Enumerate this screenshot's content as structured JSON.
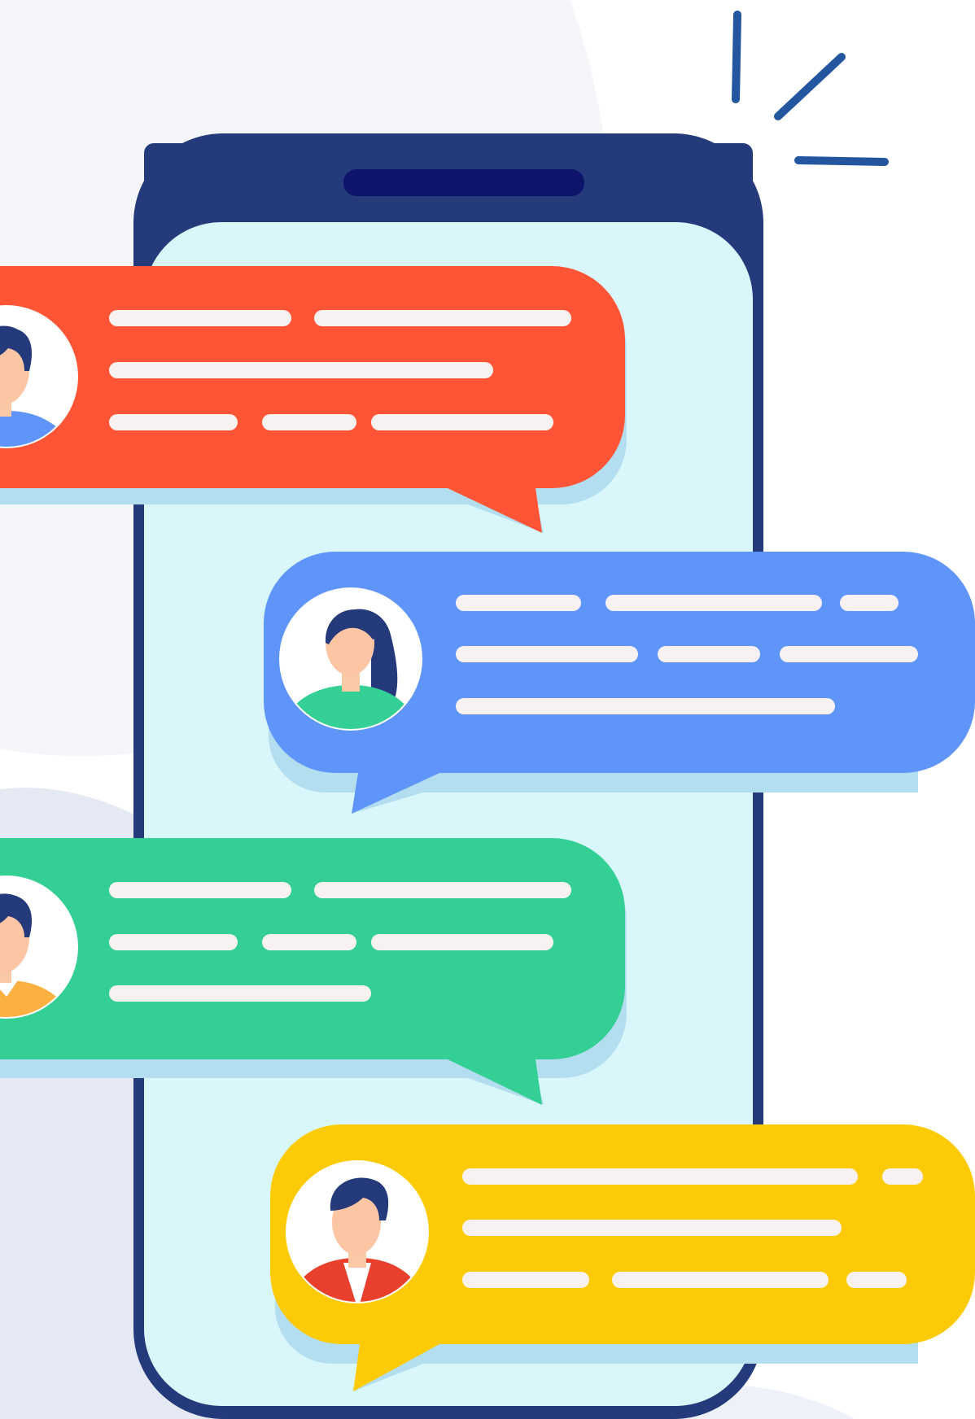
{
  "illustration": {
    "subject": "chat-app-conversation",
    "colors": {
      "background_blob": "#f3f5fa",
      "phone_frame": "#243a7a",
      "phone_screen": "#d9f7fb",
      "phone_notch": "#0d146a",
      "bubble_shadow": "#b2deef",
      "text_line": "#f8f1f1",
      "sparkle": "#2456a0",
      "bubble_red": "#ff5435",
      "bubble_blue": "#5f95f9",
      "bubble_green": "#34cf94",
      "bubble_yellow": "#fccb05"
    },
    "bubbles": [
      {
        "id": "red",
        "color": "#ff5435",
        "avatar": "man-blue-shirt-avatar",
        "text_line_rows": 3
      },
      {
        "id": "blue",
        "color": "#5f95f9",
        "avatar": "woman-green-shirt-avatar",
        "text_line_rows": 3
      },
      {
        "id": "green",
        "color": "#34cf94",
        "avatar": "man-orange-shirt-avatar",
        "text_line_rows": 3
      },
      {
        "id": "yellow",
        "color": "#fccb05",
        "avatar": "man-red-jacket-avatar",
        "text_line_rows": 3
      }
    ]
  }
}
